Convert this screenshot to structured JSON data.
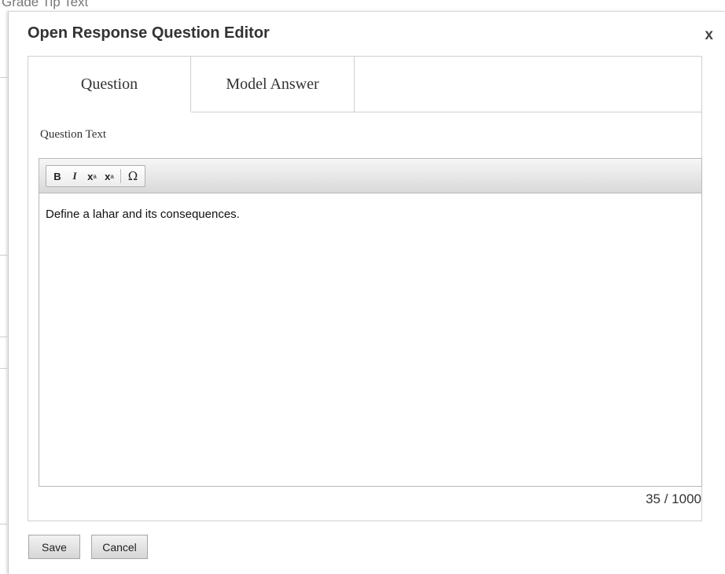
{
  "background": {
    "partial_heading": "Grade Tip Text"
  },
  "modal": {
    "title": "Open Response Question Editor",
    "close_label": "x"
  },
  "tabs": [
    {
      "label": "Question",
      "active": true
    },
    {
      "label": "Model Answer",
      "active": false
    }
  ],
  "question": {
    "field_label": "Question Text",
    "content": "Define a lahar and its consequences.",
    "char_count": "35 / 1000"
  },
  "toolbar": {
    "bold": "B",
    "italic": "I",
    "subscript": "x",
    "superscript": "x",
    "special_char": "Ω"
  },
  "footer": {
    "save_label": "Save",
    "cancel_label": "Cancel"
  }
}
